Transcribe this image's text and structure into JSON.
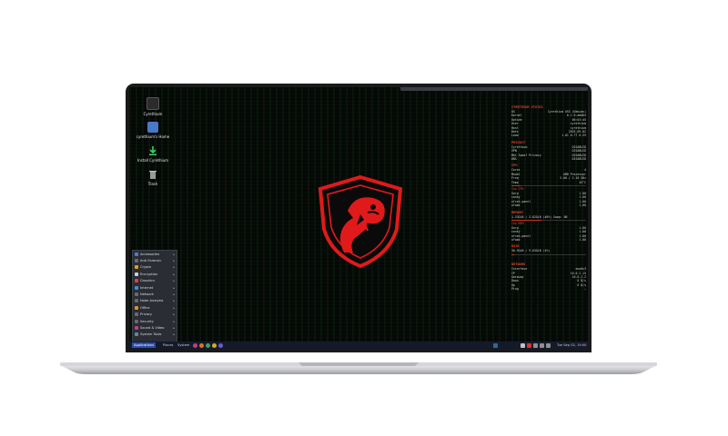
{
  "desktop": {
    "icons": [
      {
        "label": "Cyrethium",
        "icon": "computer-icon"
      },
      {
        "label": "cyrethium's Home",
        "icon": "home-folder-icon"
      },
      {
        "label": "Install Cyrethium",
        "icon": "install-icon"
      },
      {
        "label": "Trash",
        "icon": "trash-icon"
      }
    ]
  },
  "conky": {
    "status_title": "CYRETHIUM STATUS",
    "status_rows": [
      {
        "k": "OS",
        "v": "Cyrethium OSS (Debian)"
      },
      {
        "k": "Kernel",
        "v": "6.1.0-amd64"
      },
      {
        "k": "Uptime",
        "v": "00:03:45"
      },
      {
        "k": "User",
        "v": "cyrethium"
      },
      {
        "k": "Host",
        "v": "cyrethium"
      },
      {
        "k": "Date",
        "v": "2025-09-02"
      },
      {
        "k": "Load",
        "v": "1.01 0.77 0.55"
      }
    ],
    "privacy_title": "PRIVACY",
    "privacy_rows": [
      {
        "k": "Cyrethium",
        "v": "DISABLED"
      },
      {
        "k": "VPN",
        "v": "DISABLED"
      },
      {
        "k": "MAC Spoof Privacy",
        "v": "DISABLED"
      },
      {
        "k": "DNS",
        "v": "DISABLED"
      }
    ],
    "cpu_title": "CPU",
    "cpu_rows": [
      {
        "k": "Cores",
        "v": "4"
      },
      {
        "k": "Model",
        "v": "AMD Processor"
      },
      {
        "k": "Freq",
        "v": "2.00 / 2.10 GHz"
      },
      {
        "k": "Temp",
        "v": "45°C"
      }
    ],
    "cpu_usage": 0.12,
    "top_cpu_title": "Top CPU",
    "top_cpu": [
      {
        "k": "Xorg",
        "v": "1.00"
      },
      {
        "k": "conky",
        "v": "1.00"
      },
      {
        "k": "xfce4-panel",
        "v": "1.00"
      },
      {
        "k": "xfwm4",
        "v": "1.00"
      }
    ],
    "memory_title": "MEMORY",
    "memory_line": "1.53GiB / 3.82GiB  (40%)  Swap: 0B",
    "mem_usage": 0.4,
    "top_mem_title": "Top MEM",
    "top_mem": [
      {
        "k": "Xorg",
        "v": "1.80"
      },
      {
        "k": "conky",
        "v": "1.00"
      },
      {
        "k": "xfce4-panel",
        "v": "1.00"
      },
      {
        "k": "xfwm4",
        "v": "1.00"
      }
    ],
    "disk_title": "DISK",
    "disk_line": "30.9GiB / 9.63GiB  (4%)",
    "disk_usage": 0.04,
    "network_title": "NETWORK",
    "network_rows": [
      {
        "k": "Interface",
        "v": "enp0s3"
      },
      {
        "k": "IP",
        "v": "10.0.2.15"
      },
      {
        "k": "Gateway",
        "v": "10.0.2.2"
      },
      {
        "k": "Down",
        "v": "0 B/s"
      },
      {
        "k": "Up",
        "v": "0 B/s"
      },
      {
        "k": "Ping",
        "v": "—"
      }
    ]
  },
  "menu": {
    "items": [
      {
        "label": "Accessories",
        "color": "#4f7cc9"
      },
      {
        "label": "Anti-Forensic",
        "color": "#6a6a70"
      },
      {
        "label": "Crypto",
        "color": "#e0a020"
      },
      {
        "label": "Encryption",
        "color": "#d0d0d0"
      },
      {
        "label": "Graphics",
        "color": "#e04040"
      },
      {
        "label": "Internet",
        "color": "#3a8ee0"
      },
      {
        "label": "Network",
        "color": "#6a6a70"
      },
      {
        "label": "Node Analysis",
        "color": "#6a6a70"
      },
      {
        "label": "Office",
        "color": "#e09030"
      },
      {
        "label": "Privacy",
        "color": "#6a6a70"
      },
      {
        "label": "Security",
        "color": "#6a6a70"
      },
      {
        "label": "Sound & Video",
        "color": "#c04080"
      },
      {
        "label": "System Tools",
        "color": "#6a80b0"
      }
    ]
  },
  "taskbar": {
    "applications": "Applications",
    "places": "Places",
    "system": "System",
    "clock": "Tue Sep 02, 19:00"
  },
  "colors": {
    "accent": "#e0402c",
    "emblem_red": "#e01a1a",
    "panel_blue": "#2c4da8"
  }
}
